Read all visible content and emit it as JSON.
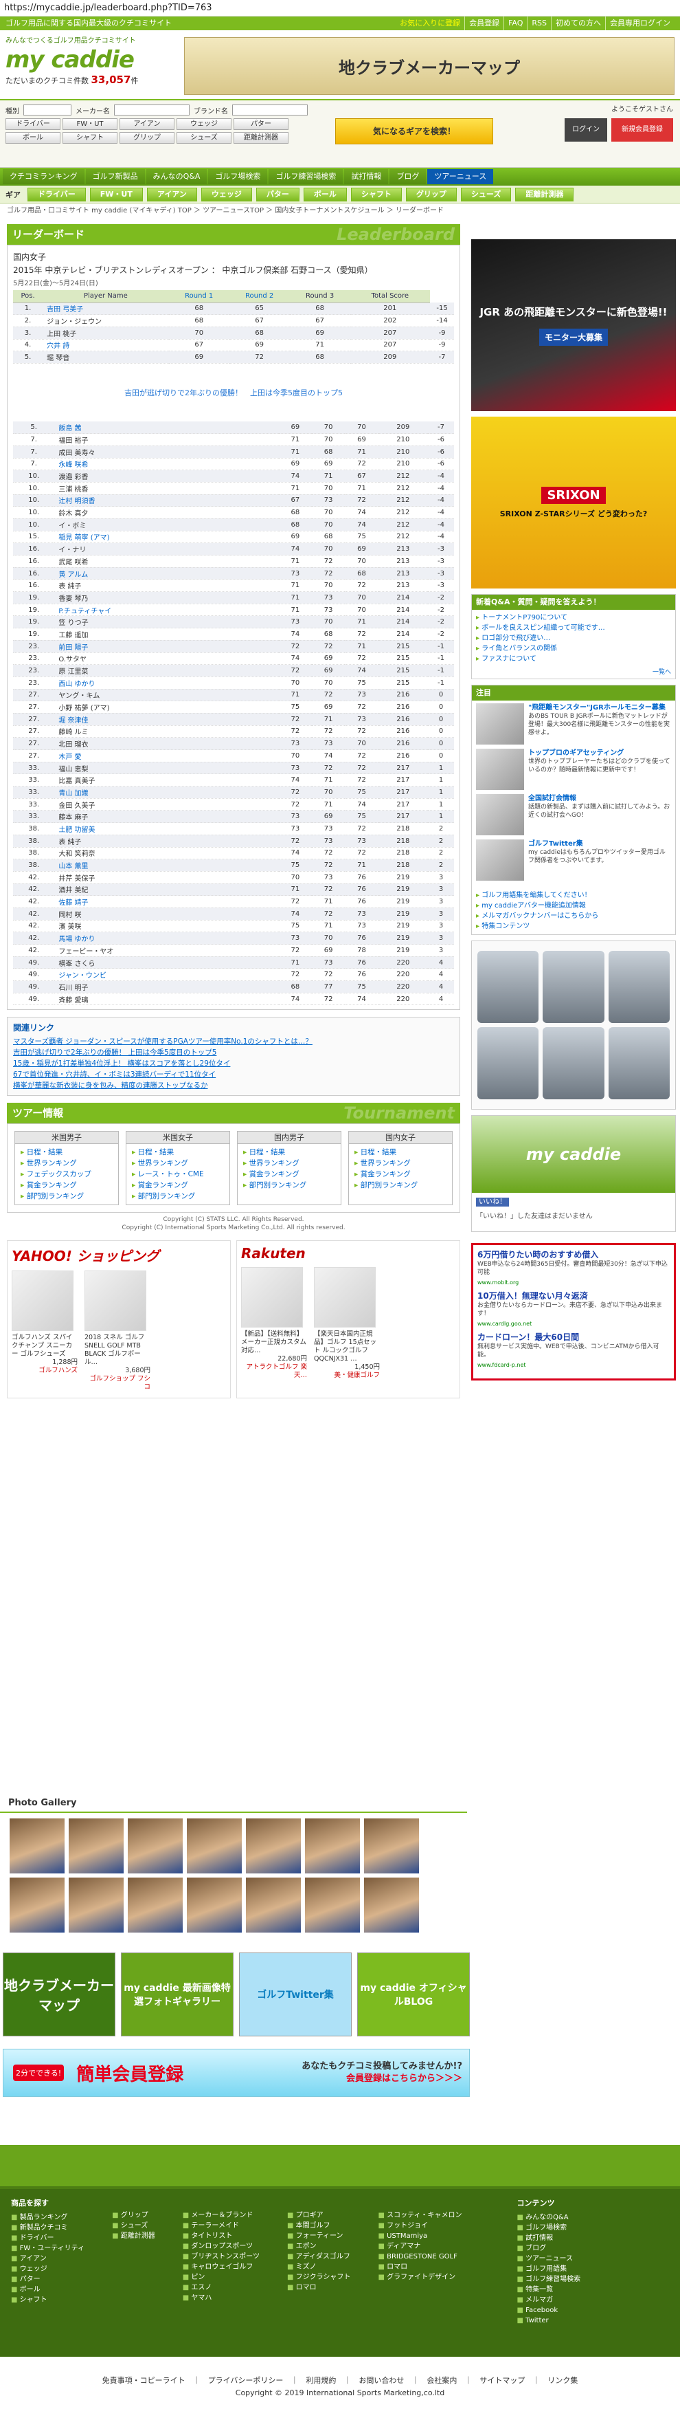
{
  "browser": {
    "url": "https://mycaddie.jp/leaderboard.php?TID=763"
  },
  "topline": {
    "tagline": "ゴルフ用品に関する国内最大級のクチコミサイト",
    "links": [
      "お気に入りに登録",
      "会員登録",
      "FAQ",
      "RSS",
      "初めての方へ",
      "会員専用ログイン"
    ]
  },
  "logo": {
    "tag": "みんなでつくるゴルフ用品クチコミサイト",
    "name": "my caddie",
    "count_label": "ただいまのクチコミ件数",
    "count_value": "33,057",
    "count_unit": "件"
  },
  "header_banner": {
    "text": "地クラブメーカーマップ"
  },
  "search": {
    "label_type": "種別",
    "label_maker": "メーカー名",
    "label_brand": "ブランド名",
    "categories": [
      "ドライバー",
      "FW・UT",
      "アイアン",
      "ウェッジ",
      "パター",
      "ボール",
      "シャフト",
      "グリップ",
      "シューズ",
      "距離計測器"
    ],
    "find_button": "気になるギアを検索！",
    "welcome": "ようこそゲストさん",
    "login": "ログイン",
    "register": "新規会員登録"
  },
  "nav": [
    "クチコミランキング",
    "ゴルフ新製品",
    "みんなのQ&A",
    "ゴルフ場検索",
    "ゴルフ練習場検索",
    "試打情報",
    "ブログ",
    "ツアーニュース"
  ],
  "gear": {
    "label": "ギア",
    "tabs": [
      "ドライバー",
      "FW・UT",
      "アイアン",
      "ウェッジ",
      "パター",
      "ボール",
      "シャフト",
      "グリップ",
      "シューズ",
      "距離計測器"
    ]
  },
  "breadcrumb": "ゴルフ用品・口コミサイト my caddie (マイキャディ) TOP ＞ ツアーニュースTOP ＞ 国内女子トーナメントスケジュール ＞ リーダーボード",
  "leaderboard": {
    "title": "リーダーボード",
    "bg_title": "Leaderboard",
    "category": "国内女子",
    "tournament": "2015年 中京テレビ・ブリヂストンレディスオープン ： 中京ゴルフ倶楽部 石野コース（愛知県）",
    "date": "5月22日(金)～5月24日(日)",
    "headers": [
      "Pos.",
      "Player Name",
      "Round 1",
      "Round 2",
      "Round 3",
      "Total Score"
    ],
    "top_rows": [
      [
        "1.",
        "吉田 弓美子",
        "68",
        "65",
        "68",
        "201",
        "-15"
      ],
      [
        "2.",
        "ジョン・ジェウン",
        "68",
        "67",
        "67",
        "202",
        "-14"
      ],
      [
        "3.",
        "上田 桃子",
        "70",
        "68",
        "69",
        "207",
        "-9"
      ],
      [
        "4.",
        "穴井 詩",
        "67",
        "69",
        "71",
        "207",
        "-9"
      ],
      [
        "5.",
        "堀 琴音",
        "69",
        "72",
        "68",
        "209",
        "-7"
      ]
    ],
    "note": "吉田が逃げ切りで2年ぶりの優勝！　上田は今季5度目のトップ5",
    "rows": [
      [
        "5.",
        "飯島 茜",
        "69",
        "70",
        "70",
        "209",
        "-7"
      ],
      [
        "7.",
        "福田 裕子",
        "71",
        "70",
        "69",
        "210",
        "-6"
      ],
      [
        "7.",
        "成田 美寿々",
        "71",
        "68",
        "71",
        "210",
        "-6"
      ],
      [
        "7.",
        "永峰 咲希",
        "69",
        "69",
        "72",
        "210",
        "-6"
      ],
      [
        "10.",
        "渡邉 彩香",
        "74",
        "71",
        "67",
        "212",
        "-4"
      ],
      [
        "10.",
        "三浦 桃香",
        "71",
        "70",
        "71",
        "212",
        "-4"
      ],
      [
        "10.",
        "辻村 明須香",
        "67",
        "73",
        "72",
        "212",
        "-4"
      ],
      [
        "10.",
        "鈴木 真夕",
        "68",
        "70",
        "74",
        "212",
        "-4"
      ],
      [
        "10.",
        "イ・ボミ",
        "68",
        "70",
        "74",
        "212",
        "-4"
      ],
      [
        "15.",
        "稲見 萌寧 (アマ)",
        "69",
        "68",
        "75",
        "212",
        "-4"
      ],
      [
        "16.",
        "イ・ナリ",
        "74",
        "70",
        "69",
        "213",
        "-3"
      ],
      [
        "16.",
        "武尾 咲希",
        "71",
        "72",
        "70",
        "213",
        "-3"
      ],
      [
        "16.",
        "黄 アルム",
        "73",
        "72",
        "68",
        "213",
        "-3"
      ],
      [
        "16.",
        "表 純子",
        "71",
        "70",
        "72",
        "213",
        "-3"
      ],
      [
        "19.",
        "香妻 琴乃",
        "71",
        "73",
        "70",
        "214",
        "-2"
      ],
      [
        "19.",
        "P.チュティチャイ",
        "71",
        "73",
        "70",
        "214",
        "-2"
      ],
      [
        "19.",
        "笠 りつ子",
        "73",
        "70",
        "71",
        "214",
        "-2"
      ],
      [
        "19.",
        "工藤 遥加",
        "74",
        "68",
        "72",
        "214",
        "-2"
      ],
      [
        "23.",
        "前田 陽子",
        "72",
        "72",
        "71",
        "215",
        "-1"
      ],
      [
        "23.",
        "O.サタヤ",
        "74",
        "69",
        "72",
        "215",
        "-1"
      ],
      [
        "23.",
        "原 江里菜",
        "72",
        "69",
        "74",
        "215",
        "-1"
      ],
      [
        "23.",
        "西山 ゆかり",
        "70",
        "70",
        "75",
        "215",
        "-1"
      ],
      [
        "27.",
        "ヤング・キム",
        "71",
        "72",
        "73",
        "216",
        "0"
      ],
      [
        "27.",
        "小野 祐夢 (アマ)",
        "75",
        "69",
        "72",
        "216",
        "0"
      ],
      [
        "27.",
        "堀 奈津佳",
        "72",
        "71",
        "73",
        "216",
        "0"
      ],
      [
        "27.",
        "藤崎 ルミ",
        "72",
        "72",
        "72",
        "216",
        "0"
      ],
      [
        "27.",
        "北田 瑠衣",
        "73",
        "73",
        "70",
        "216",
        "0"
      ],
      [
        "27.",
        "木戸 愛",
        "70",
        "74",
        "72",
        "216",
        "0"
      ],
      [
        "33.",
        "福山 恵梨",
        "73",
        "72",
        "72",
        "217",
        "1"
      ],
      [
        "33.",
        "比嘉 真美子",
        "74",
        "71",
        "72",
        "217",
        "1"
      ],
      [
        "33.",
        "青山 加織",
        "72",
        "70",
        "75",
        "217",
        "1"
      ],
      [
        "33.",
        "金田 久美子",
        "72",
        "71",
        "74",
        "217",
        "1"
      ],
      [
        "33.",
        "藤本 麻子",
        "73",
        "69",
        "75",
        "217",
        "1"
      ],
      [
        "38.",
        "土肥 功留美",
        "73",
        "73",
        "72",
        "218",
        "2"
      ],
      [
        "38.",
        "表 純子",
        "72",
        "73",
        "73",
        "218",
        "2"
      ],
      [
        "38.",
        "大和 笑莉奈",
        "74",
        "72",
        "72",
        "218",
        "2"
      ],
      [
        "38.",
        "山本 薫里",
        "75",
        "72",
        "71",
        "218",
        "2"
      ],
      [
        "42.",
        "井芹 美保子",
        "70",
        "73",
        "76",
        "219",
        "3"
      ],
      [
        "42.",
        "酒井 美紀",
        "71",
        "72",
        "76",
        "219",
        "3"
      ],
      [
        "42.",
        "佐藤 靖子",
        "72",
        "71",
        "76",
        "219",
        "3"
      ],
      [
        "42.",
        "岡村 咲",
        "74",
        "72",
        "73",
        "219",
        "3"
      ],
      [
        "42.",
        "濱 美咲",
        "75",
        "71",
        "73",
        "219",
        "3"
      ],
      [
        "42.",
        "馬場 ゆかり",
        "73",
        "70",
        "76",
        "219",
        "3"
      ],
      [
        "42.",
        "フェービー・ヤオ",
        "72",
        "69",
        "78",
        "219",
        "3"
      ],
      [
        "49.",
        "横峯 さくら",
        "71",
        "73",
        "76",
        "220",
        "4"
      ],
      [
        "49.",
        "ジャン・ウンビ",
        "72",
        "72",
        "76",
        "220",
        "4"
      ],
      [
        "49.",
        "石川 明子",
        "68",
        "77",
        "75",
        "220",
        "4"
      ],
      [
        "49.",
        "斉藤 愛璃",
        "74",
        "72",
        "74",
        "220",
        "4"
      ]
    ]
  },
  "related": {
    "title": "関連リンク",
    "items": [
      "マスターズ覇者 ジョーダン・スピースが使用するPGAツアー使用率No.1のシャフトとは…？",
      "吉田が逃げ切りで2年ぶりの優勝！ 上田は今季5度目のトップ5",
      "15歳・稲見が1打差単独4位浮上！ 横峯はスコアを落とし29位タイ",
      "67で首位発進・穴井詩、イ・ボミは3連続バーディで11位タイ",
      "横峯が華麗な新衣装に身を包み、精度の連勝ストップなるか"
    ]
  },
  "tour_info": {
    "title": "ツアー情報",
    "bg_title": "Tournament",
    "columns": [
      {
        "name": "米国男子",
        "links": [
          "日程・結果",
          "世界ランキング",
          "フェデックスカップ",
          "賞金ランキング",
          "部門別ランキング"
        ]
      },
      {
        "name": "米国女子",
        "links": [
          "日程・結果",
          "世界ランキング",
          "レース・トゥ・CME",
          "賞金ランキング",
          "部門別ランキング"
        ]
      },
      {
        "name": "国内男子",
        "links": [
          "日程・結果",
          "世界ランキング",
          "賞金ランキング",
          "部門別ランキング"
        ]
      },
      {
        "name": "国内女子",
        "links": [
          "日程・結果",
          "世界ランキング",
          "賞金ランキング",
          "部門別ランキング"
        ]
      }
    ],
    "copyright1": "Copyright (C) STATS LLC. All Rights Reserved.",
    "copyright2": "Copyright (C) International Sports Marketing Co.,Ltd. All rights reserved."
  },
  "shopping": {
    "yahoo": {
      "logo": "YAHOO! ショッピング",
      "items": [
        {
          "title": "ゴルフハンズ スパイクチャンプ スニーカー ゴルフシューズ",
          "price": "1,288円",
          "shop": "ゴルフハンズ"
        },
        {
          "title": "2018 スネル ゴルフ SNELL GOLF MTB BLACK ゴルフボール…",
          "price": "3,680円",
          "shop": "ゴルフショップ フシコ"
        }
      ]
    },
    "rakuten": {
      "logo": "Rakuten",
      "items": [
        {
          "title": "【新品】【送料無料】 メーカー正規カスタム対応…",
          "price": "22,680円",
          "shop": "アトラクトゴルフ 楽天…"
        },
        {
          "title": "【楽天日本国内正規品】ゴルフ 15点セット ルコックゴルフ QQCNJX31 …",
          "price": "1,450円",
          "shop": "美・健康ゴルフ"
        }
      ]
    }
  },
  "photo_gallery": {
    "title": "Photo Gallery"
  },
  "promos": {
    "p1": "地クラブメーカーマップ",
    "p2": "my caddie 最新画像特選フォトギャラリー",
    "p3": "ゴルフTwitter集",
    "p4": "my caddie オフィシャルBLOG"
  },
  "signup": {
    "badge": "2分でできる!",
    "main": "簡単会員登録",
    "q1": "あなたもクチコミ投稿してみませんか!?",
    "q2": "会員登録はこちらから＞＞＞"
  },
  "right": {
    "ad1_text": "JGR あの飛距離モンスターに新色登場!!",
    "ad1_button": "モニター大募集",
    "ad2_brand": "SRIXON",
    "ad2_text": "SRIXON Z-STARシリーズ どう変わった?",
    "qa_title": "新着Q&A・質問・疑問を答えよう！",
    "qa_items": [
      "トーナメントP790について",
      "ボールを良えスピン組織って可能です…",
      "ロゴ部分で飛び違い…",
      "ライ角とバランスの関係",
      "ファスナについて"
    ],
    "qa_more": "一覧へ",
    "notice_title": "注目",
    "news": [
      {
        "title": "\"飛距離モンスター\"JGRホールモニター募集",
        "desc": "あのBS TOUR B JGRボールに新色マットレッドが登場！最大300名様に飛距離モンスターの性能を実感せよ。"
      },
      {
        "title": "トップブロのギアセッティング",
        "desc": "世界のトップブレーヤーたちはどのクラブを使っているのか？随時最新情報に更新中です！"
      },
      {
        "title": "全国試打会情報",
        "desc": "話題の新製品、まずは購入前に試打してみよう。お近くの試打会へGO！"
      },
      {
        "title": "ゴルフTwitter集",
        "desc": "my caddieはもちろんプロやツイッター愛用ゴルフ関係者をつぶやいてます。"
      }
    ],
    "links": [
      "ゴルフ用語集を編集してください！",
      "my caddieアバター機能追加情報",
      "メルマガバックナンバーはこちらから",
      "特集コンテンツ"
    ],
    "fb_logo": "my caddie",
    "fb_like": "いいね！",
    "fb_text": "「いいね！」した友達はまだいません",
    "ad3_items": [
      {
        "t": "6万円借りたい時のおすすめ借入",
        "d": "WEB申込なら24時間365日受付。審査時間最短30分！急ぎ以下申込可能",
        "u": "www.mobit.org"
      },
      {
        "t": "10万借入！無理ない月々返済",
        "d": "お金借りたいならカードローン。来店不要、急ぎ以下申込み出来ます！",
        "u": "www.cardlg.goo.net"
      },
      {
        "t": "カードローン！最大60日間",
        "d": "無利息サービス実施中。WEBで申込後、コンビニATMから借入可能。",
        "u": "www.fdcard-p.net"
      }
    ]
  },
  "footer": {
    "col1_title": "商品を探す",
    "col1": [
      "製品ランキング",
      "新製品クチコミ",
      "ドライバー",
      "FW・ユーティリティ",
      "アイアン",
      "ウェッジ",
      "パター",
      "ボール",
      "シャフト"
    ],
    "col2": [
      "グリップ",
      "シューズ",
      "距離計測器"
    ],
    "col3": [
      "メーカー＆ブランド",
      "テーラーメイド",
      "タイトリスト",
      "ダンロップスポーツ",
      "ブリヂストンスポーツ",
      "キャロウェイゴルフ",
      "ピン",
      "エスノ",
      "ヤマハ"
    ],
    "col4": [
      "プロギア",
      "本間ゴルフ",
      "フォーティーン",
      "エポン",
      "アディダスゴルフ",
      "ミズノ",
      "フジクラシャフト",
      "ロマロ"
    ],
    "col5": [
      "スコッティ・キャメロン",
      "フットジョイ",
      "USTMamiya",
      "ディアマナ",
      "BRIDGESTONE GOLF",
      "ロマロ",
      "グラファイトデザイン"
    ],
    "col6_title": "コンテンツ",
    "col6": [
      "みんなのQ&A",
      "ゴルフ場検索",
      "試打情報",
      "ブログ",
      "ツアーニュース",
      "ゴルフ用語集",
      "ゴルフ練習場検索",
      "特集一覧",
      "メルマガ",
      "Facebook",
      "Twitter"
    ],
    "bottom_links": "免責事項・コピーライト　｜　プライバシーポリシー　｜　利用規約　｜　お問い合わせ　｜　会社案内　｜　サイトマップ　｜　リンク集",
    "copyright": "Copyright © 2019 International Sports Marketing,co.ltd"
  }
}
